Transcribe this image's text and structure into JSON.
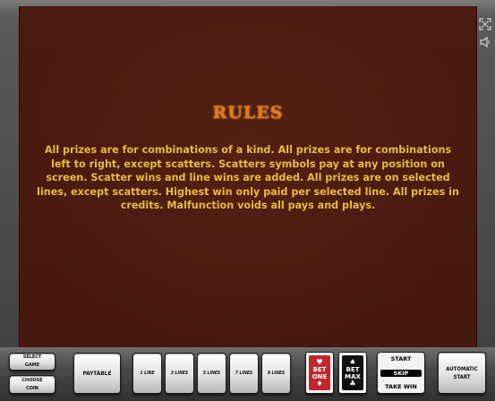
{
  "screen": {
    "title": "RULES",
    "rules_text": "All prizes are for combinations of a kind. All prizes are for combinations left to right, except scatters. Scatters symbols pay at any position on screen. Scatter wins and line wins are added. All prizes are on selected lines, except scatters. Highest win only paid per selected line.  All prizes in credits. Malfunction voids all pays and plays."
  },
  "side": {
    "fullscreen_icon": "fullscreen-icon",
    "sound_icon": "speaker-icon"
  },
  "controls": {
    "select_game": "SELECT GAME",
    "choose_coin": "CHOOSE COIN",
    "paytable": "PAYTABLE",
    "lines": [
      "1 LINE",
      "3 LINES",
      "5 LINES",
      "7 LINES",
      "9 LINES"
    ],
    "bet_one": "BET ONE",
    "bet_max": "BET MAX",
    "start": "START",
    "skip": "SKIP",
    "take_win": "TAKE WIN",
    "automatic_start": "AUTOMATIC START"
  },
  "colors": {
    "screen_bg": "#4a1910",
    "title": "#e07a18",
    "text": "#e8bd3a",
    "bet_one_card": "#c0282d"
  }
}
